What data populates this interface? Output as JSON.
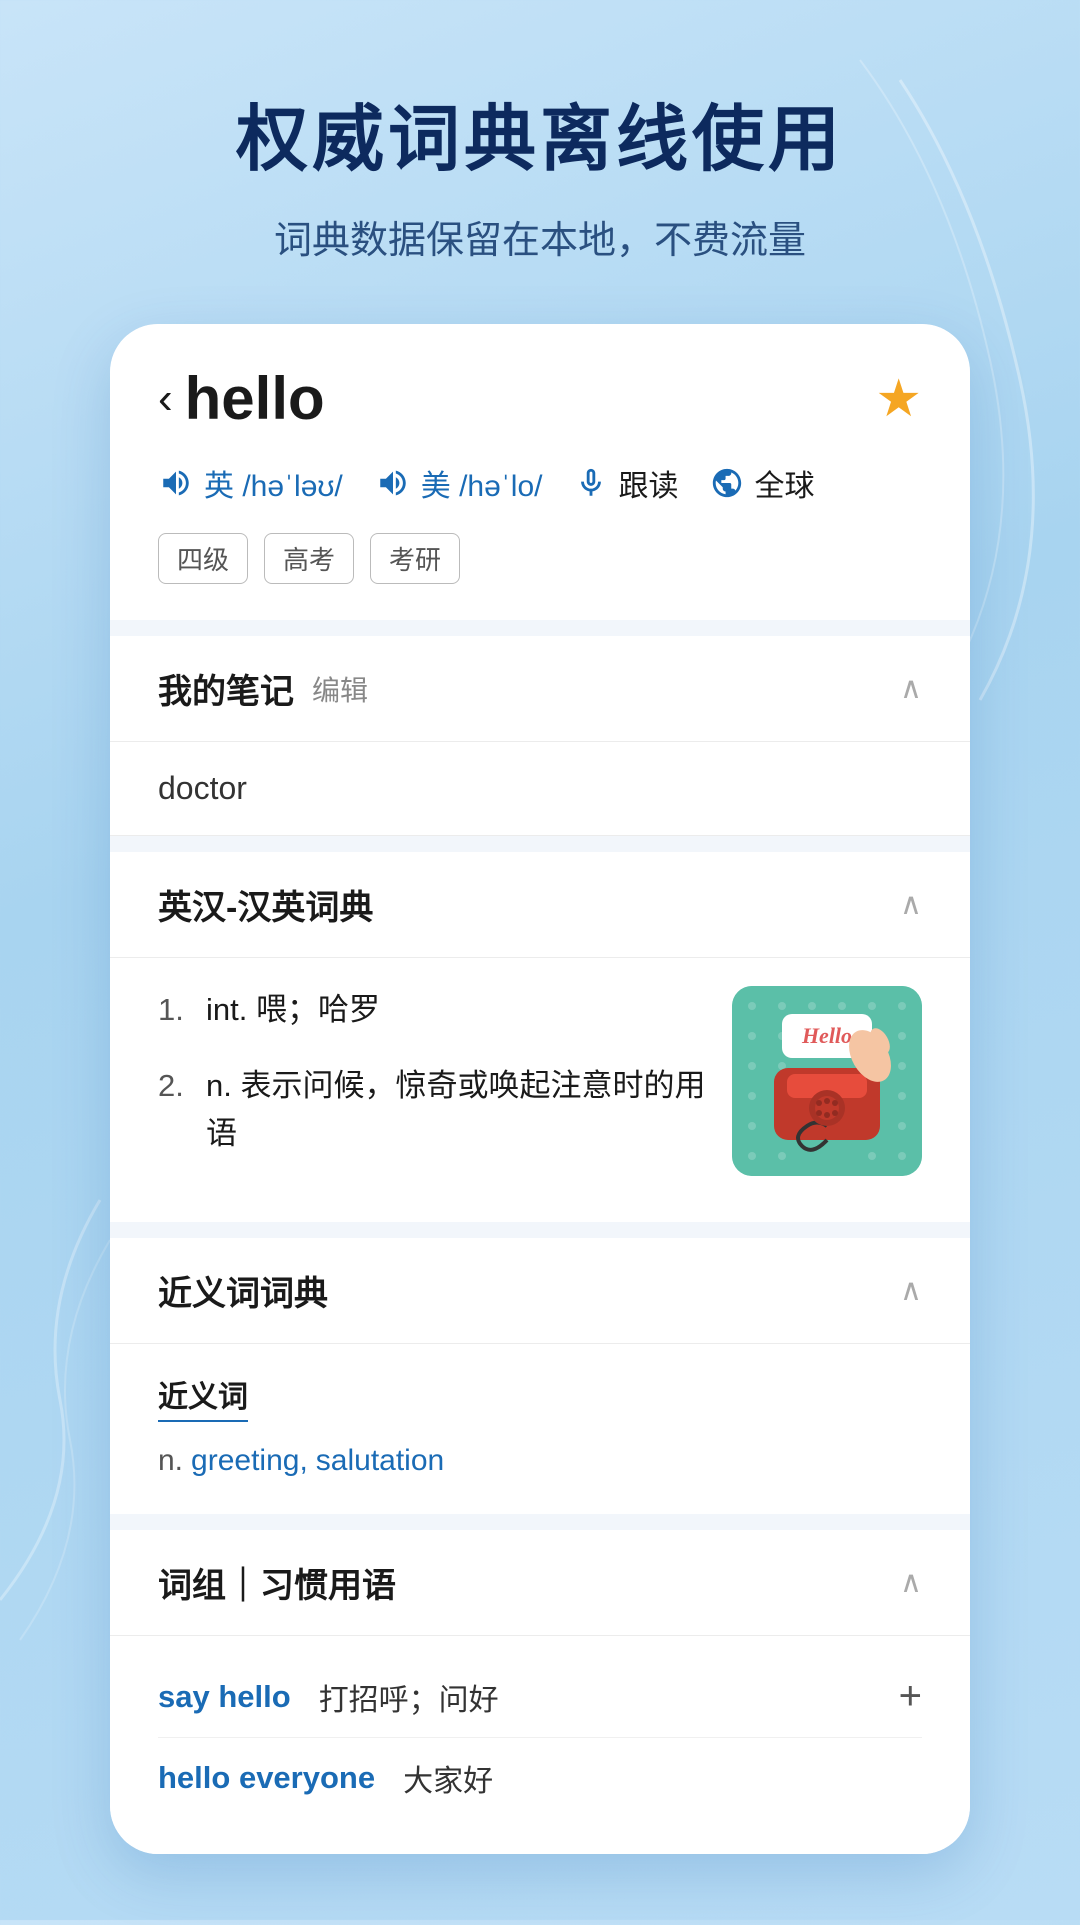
{
  "background": {
    "color_start": "#c8e4f8",
    "color_end": "#a8d4f0"
  },
  "hero": {
    "title": "权威词典离线使用",
    "subtitle": "词典数据保留在本地，不费流量"
  },
  "word_card": {
    "back_symbol": "‹",
    "word": "hello",
    "star_label": "★",
    "pronunciations": [
      {
        "flag": "英",
        "ipa": "/həˈləʊ/"
      },
      {
        "flag": "美",
        "ipa": "/həˈlo/"
      }
    ],
    "follow_read_label": "跟读",
    "global_label": "全球",
    "tags": [
      "四级",
      "高考",
      "考研"
    ],
    "sections": {
      "my_notes": {
        "title": "我的笔记",
        "edit_label": "编辑",
        "content": "doctor"
      },
      "dictionary": {
        "title": "英汉-汉英词典",
        "definitions": [
          {
            "num": "1.",
            "pos": "int.",
            "meaning": "喂；哈罗"
          },
          {
            "num": "2.",
            "pos": "n.",
            "meaning": "表示问候，惊奇或唤起注意时的用语"
          }
        ]
      },
      "synonyms": {
        "title": "近义词词典",
        "label": "近义词",
        "pos": "n.",
        "words": [
          "greeting",
          "salutation"
        ]
      },
      "phrases": {
        "title": "词组｜习惯用语",
        "items": [
          {
            "phrase": "say hello",
            "meaning": "打招呼；问好",
            "has_add": true
          },
          {
            "phrase": "hello everyone",
            "meaning": "大家好",
            "has_add": false
          }
        ]
      }
    }
  }
}
